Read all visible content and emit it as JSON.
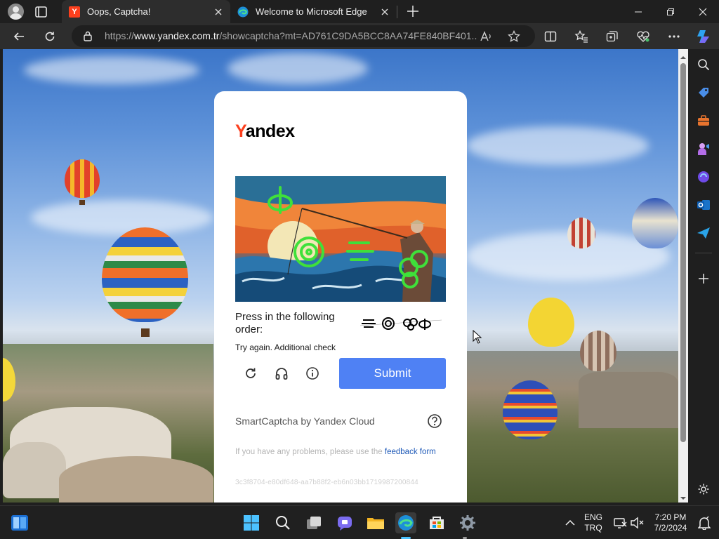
{
  "tabs": [
    {
      "title": "Oops, Captcha!",
      "favicon_letter": "Y",
      "active": true
    },
    {
      "title": "Welcome to Microsoft Edge",
      "active": false
    }
  ],
  "address": {
    "url_prefix": "https://",
    "url_host": "www.yandex.com.tr",
    "url_rest": "/showcaptcha?mt=AD761C9DA5BCC8AA74FE840BF401..."
  },
  "captcha": {
    "logo_first": "Y",
    "logo_rest": "andex",
    "instruction": "Press in the following order:",
    "retry_text": "Try again. Additional check",
    "submit_label": "Submit",
    "brand_line": "SmartCaptcha by Yandex Cloud",
    "problems_text": "If you have any problems, please use the ",
    "feedback_link": "feedback form",
    "hash": "3c3f8704-e80df648-aa7b88f2-eb6n03bb1719987200844"
  },
  "taskbar": {
    "lang_top": "ENG",
    "lang_bottom": "TRQ",
    "time": "7:20 PM",
    "date": "7/2/2024"
  },
  "colors": {
    "yandex_red": "#fc3f1d",
    "submit_blue": "#4f81f4",
    "link_blue": "#1f5ab8"
  }
}
